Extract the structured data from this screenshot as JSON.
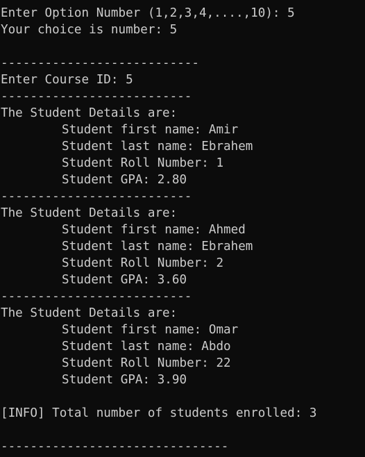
{
  "console": {
    "background": "#0c0c0c",
    "foreground": "#cccccc",
    "prompt_option": "Enter Option Number (1,2,3,4,....,10): 5",
    "choice_echo": "Your choice is number: 5",
    "separator_1": "---------------------------",
    "prompt_course": "Enter Course ID: 5",
    "separator_2": "--------------------------",
    "students": [
      {
        "header": "The Student Details are:",
        "first_name": "Student first name: Amir",
        "last_name": "Student last name: Ebrahem",
        "roll": "Student Roll Number: 1",
        "gpa": "Student GPA: 2.80",
        "separator": "--------------------------"
      },
      {
        "header": "The Student Details are:",
        "first_name": "Student first name: Ahmed",
        "last_name": "Student last name: Ebrahem",
        "roll": "Student Roll Number: 2",
        "gpa": "Student GPA: 3.60",
        "separator": "--------------------------"
      },
      {
        "header": "The Student Details are:",
        "first_name": "Student first name: Omar",
        "last_name": "Student last name: Abdo",
        "roll": "Student Roll Number: 22",
        "gpa": "Student GPA: 3.90"
      }
    ],
    "info_total": "[INFO] Total number of students enrolled: 3",
    "separator_end": "-------------------------------"
  }
}
